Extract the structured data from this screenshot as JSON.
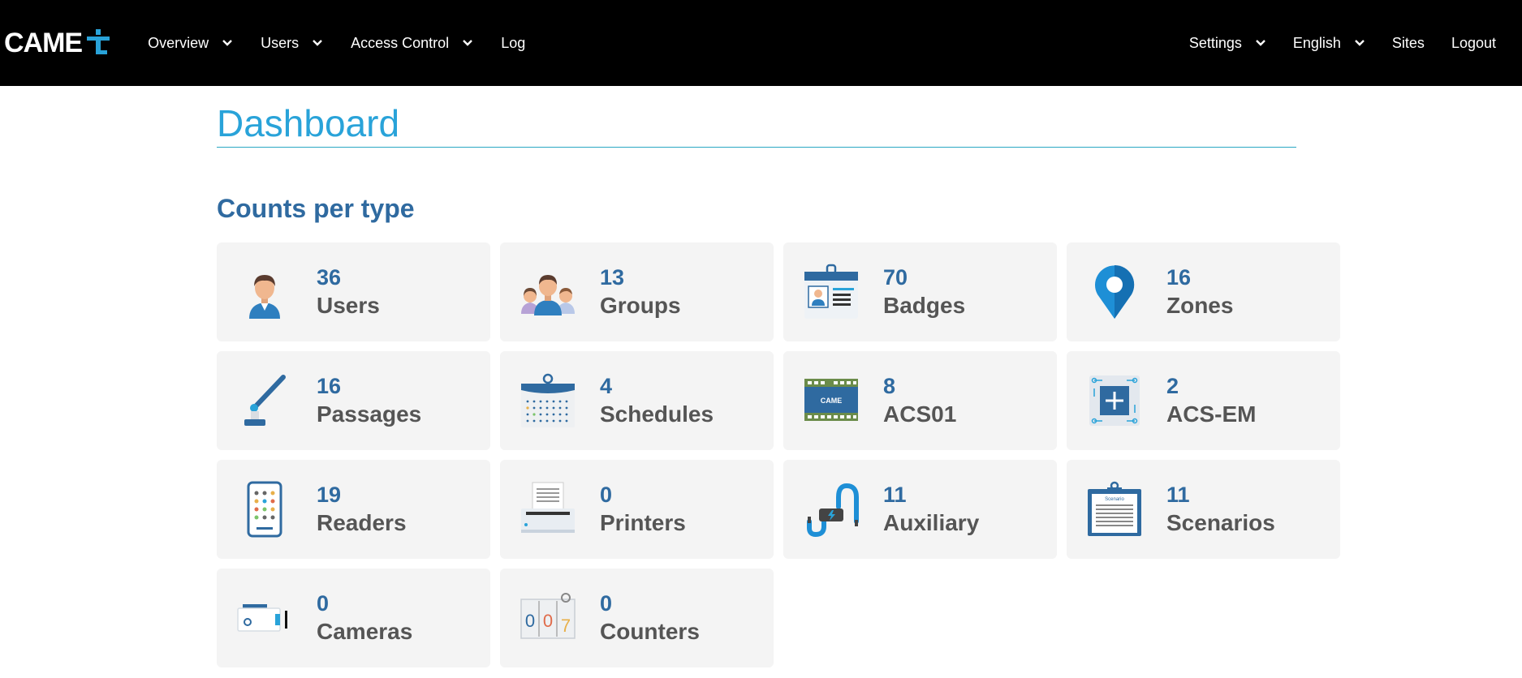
{
  "brand": {
    "logo_text": "CAME"
  },
  "nav": {
    "left": [
      {
        "label": "Overview",
        "dropdown": true
      },
      {
        "label": "Users",
        "dropdown": true
      },
      {
        "label": "Access Control",
        "dropdown": true
      },
      {
        "label": "Log",
        "dropdown": false
      }
    ],
    "right": [
      {
        "label": "Settings",
        "dropdown": true
      },
      {
        "label": "English",
        "dropdown": true
      },
      {
        "label": "Sites",
        "dropdown": false
      },
      {
        "label": "Logout",
        "dropdown": false
      }
    ]
  },
  "page": {
    "title": "Dashboard",
    "section_title": "Counts per type"
  },
  "cards": [
    {
      "count": "36",
      "label": "Users",
      "icon": "user-icon"
    },
    {
      "count": "13",
      "label": "Groups",
      "icon": "group-icon"
    },
    {
      "count": "70",
      "label": "Badges",
      "icon": "badge-icon"
    },
    {
      "count": "16",
      "label": "Zones",
      "icon": "location-pin-icon"
    },
    {
      "count": "16",
      "label": "Passages",
      "icon": "barrier-icon"
    },
    {
      "count": "4",
      "label": "Schedules",
      "icon": "calendar-icon"
    },
    {
      "count": "8",
      "label": "ACS01",
      "icon": "controller-module-icon"
    },
    {
      "count": "2",
      "label": "ACS-EM",
      "icon": "expansion-module-icon"
    },
    {
      "count": "19",
      "label": "Readers",
      "icon": "keypad-reader-icon"
    },
    {
      "count": "0",
      "label": "Printers",
      "icon": "printer-icon"
    },
    {
      "count": "11",
      "label": "Auxiliary",
      "icon": "auxiliary-cable-icon"
    },
    {
      "count": "11",
      "label": "Scenarios",
      "icon": "clipboard-icon"
    },
    {
      "count": "0",
      "label": "Cameras",
      "icon": "camera-icon"
    },
    {
      "count": "0",
      "label": "Counters",
      "icon": "counter-icon"
    }
  ],
  "icon_labels": {
    "acs01_module_text": "CAME",
    "scenario_clipboard_text": "Scenario",
    "counter_digits": [
      "0",
      "0",
      "7"
    ]
  },
  "colors": {
    "topbar": "#000000",
    "title": "#29a3d9",
    "accent_blue": "#2f6aa0",
    "card_bg": "#f4f4f4",
    "label_gray": "#555555"
  }
}
